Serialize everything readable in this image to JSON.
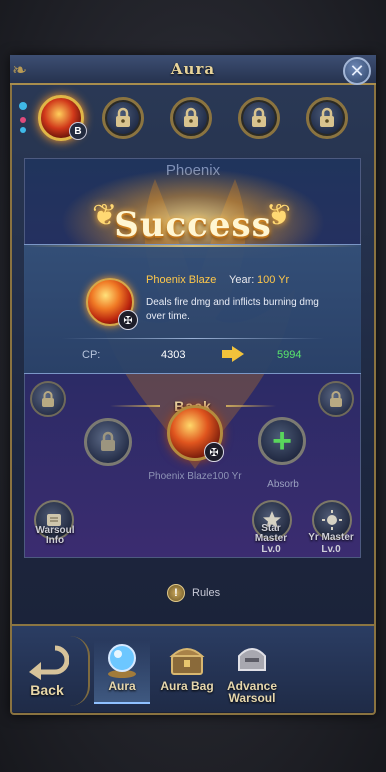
{
  "window": {
    "title": "Aura",
    "close_label": "✕"
  },
  "slots": [
    {
      "state": "active",
      "badge": "B"
    },
    {
      "state": "locked"
    },
    {
      "state": "locked"
    },
    {
      "state": "locked"
    },
    {
      "state": "locked"
    }
  ],
  "panel": {
    "category_label": "Phoenix",
    "back_label": "Back",
    "center_item_name": "Phoenix Blaze100 Yr",
    "absorb_label": "Absorb",
    "warsoul_info_label": "Warsoul\nInfo",
    "star_master": {
      "label": "Star\nMaster",
      "level": "Lv.0"
    },
    "yr_master": {
      "label": "Yr Master",
      "level": "Lv.0"
    }
  },
  "success": {
    "title": "Success",
    "item_name": "Phoenix Blaze",
    "year_label": "Year:",
    "year_value": "100 Yr",
    "description": "Deals fire dmg and inflicts burning dmg over time.",
    "cp_label": "CP:",
    "cp_old": "4303",
    "cp_new": "5994",
    "badge_icon": "sword-shield-icon"
  },
  "rules_label": "Rules",
  "bottom_nav": {
    "back_label": "Back",
    "tabs": [
      {
        "label": "Aura",
        "icon": "crystal-orb-icon",
        "active": true
      },
      {
        "label": "Aura Bag",
        "icon": "treasure-chest-icon",
        "active": false
      },
      {
        "label": "Advance\nWarsoul",
        "icon": "stone-helmet-icon",
        "active": false
      }
    ]
  },
  "colors": {
    "accent_gold": "#e0b647",
    "cp_increase": "#59e66c",
    "item_name": "#ffc84a",
    "panel_blue": "#20345c"
  }
}
